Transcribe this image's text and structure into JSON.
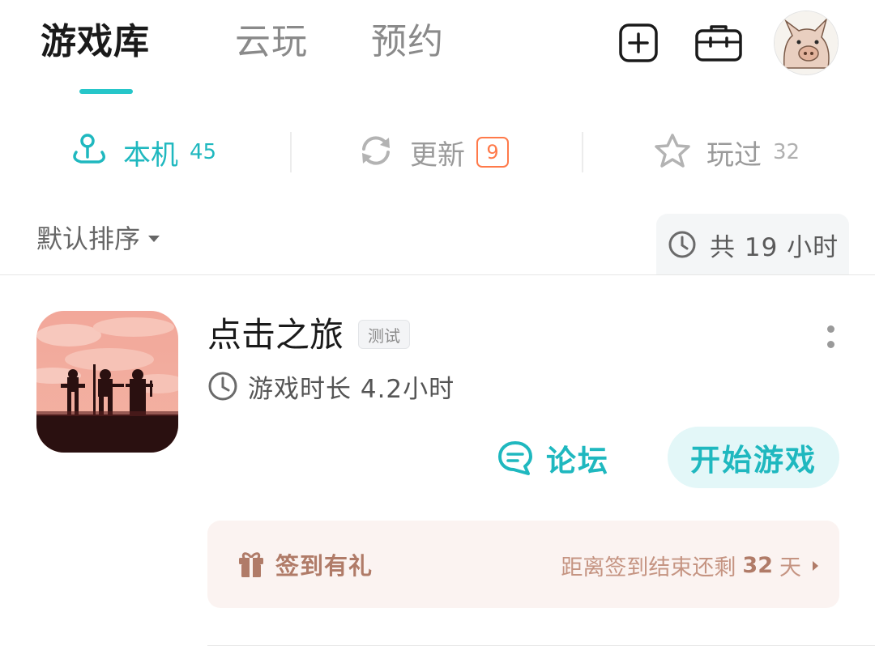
{
  "header": {
    "tabs": [
      {
        "label": "游戏库",
        "active": true
      },
      {
        "label": "云玩",
        "active": false
      },
      {
        "label": "预约",
        "active": false
      }
    ],
    "icons": [
      "add-square-icon",
      "toolbox-icon",
      "avatar"
    ]
  },
  "segments": [
    {
      "label": "本机",
      "count": "45",
      "active": true,
      "icon": "local-device-icon"
    },
    {
      "label": "更新",
      "count": "9",
      "active": false,
      "icon": "refresh-icon"
    },
    {
      "label": "玩过",
      "count": "32",
      "active": false,
      "icon": "star-icon"
    }
  ],
  "sort": {
    "label": "默认排序"
  },
  "total_time": {
    "label": "共 19 小时"
  },
  "game": {
    "title": "点击之旅",
    "tag": "测试",
    "playtime_label": "游戏时长 4.2小时",
    "forum_label": "论坛",
    "start_label": "开始游戏",
    "checkin": {
      "label": "签到有礼",
      "remaining_prefix": "距离签到结束还剩",
      "remaining_days": "32",
      "remaining_suffix": "天"
    }
  },
  "colors": {
    "accent": "#1fb8bf",
    "badge": "#ff7a4a",
    "checkin_bg": "#fbf3f1",
    "checkin_text": "#b07b68"
  }
}
